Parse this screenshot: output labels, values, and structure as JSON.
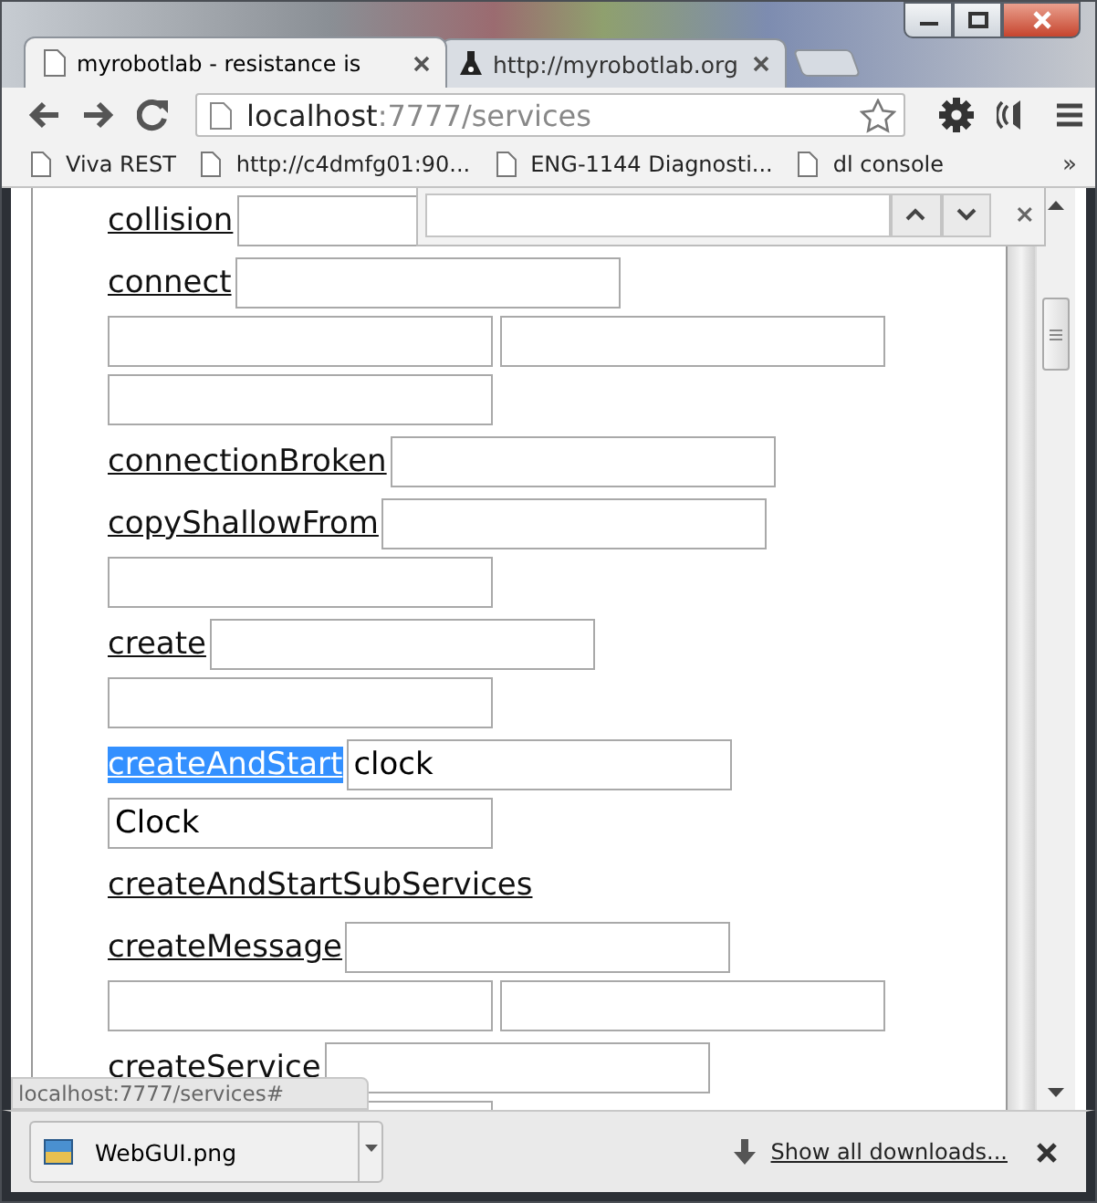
{
  "tabs": [
    {
      "title": "myrobotlab - resistance is",
      "selected": true,
      "kind": "page"
    },
    {
      "title": "http://myrobotlab.org",
      "selected": false,
      "kind": "flask"
    }
  ],
  "address": {
    "host": "localhost",
    "path": ":7777/services"
  },
  "bookmarks": [
    {
      "label": "Viva REST"
    },
    {
      "label": "http://c4dmfg01:90..."
    },
    {
      "label": "ENG-1144 Diagnosti..."
    },
    {
      "label": "dl console"
    }
  ],
  "bookmarks_more": "»",
  "methods": [
    {
      "name": "collision",
      "selected": false,
      "fields": [
        {
          "kind": "input"
        }
      ]
    },
    {
      "name": "connect",
      "selected": false,
      "fields": [
        {
          "kind": "input"
        },
        {
          "kind": "input"
        },
        {
          "kind": "input"
        },
        {
          "kind": "input"
        }
      ]
    },
    {
      "name": "connectionBroken",
      "selected": false,
      "fields": [
        {
          "kind": "input"
        }
      ]
    },
    {
      "name": "copyShallowFrom",
      "selected": false,
      "fields": [
        {
          "kind": "input"
        },
        {
          "kind": "input"
        }
      ]
    },
    {
      "name": "create",
      "selected": false,
      "fields": [
        {
          "kind": "input"
        },
        {
          "kind": "input"
        }
      ]
    },
    {
      "name": "createAndStart",
      "selected": true,
      "fields": [
        {
          "kind": "input",
          "value": "clock"
        },
        {
          "kind": "input",
          "value": "Clock"
        }
      ]
    },
    {
      "name": "createAndStartSubServices",
      "selected": false
    },
    {
      "name": "createMessage",
      "selected": false,
      "fields": [
        {
          "kind": "input"
        },
        {
          "kind": "input"
        },
        {
          "kind": "input"
        }
      ]
    },
    {
      "name": "createService",
      "selected": false,
      "fields": [
        {
          "kind": "input"
        },
        {
          "kind": "input"
        }
      ]
    }
  ],
  "find_bar": {
    "kind": "find"
  },
  "status_url": "localhost:7777/services#",
  "download": {
    "file": "WebGUI.png",
    "show_all": "Show all downloads..."
  }
}
